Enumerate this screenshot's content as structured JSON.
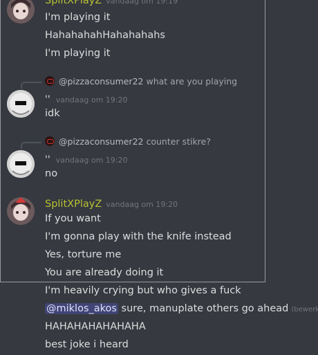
{
  "messages": [
    {
      "author": "SplitXPlayZ",
      "timestamp": "vandaag om 19:19",
      "lines": [
        "I'm playing it",
        "HahahahahHahahahahs",
        "I'm playing it"
      ]
    },
    {
      "reply": {
        "name": "@pizzaconsumer22",
        "snippet": "what are you playing"
      },
      "prefix": "''",
      "timestamp": "vandaag om 19:20",
      "lines": [
        "idk"
      ]
    },
    {
      "reply": {
        "name": "@pizzaconsumer22",
        "snippet": "counter stikre?"
      },
      "prefix": "''",
      "timestamp": "vandaag om 19:20",
      "lines": [
        "no"
      ]
    },
    {
      "author": "SplitXPlayZ",
      "timestamp": "vandaag om 19:20",
      "lines": [
        "If you want",
        "I'm gonna play with the knife instead",
        "Yes, torture me",
        "You are already doing it",
        "I'm heavily crying but who gives a fuck"
      ],
      "mention_line": {
        "mention": "@miklos_akos",
        "text": " sure, manuplate others go ahead",
        "edited": "(bewerkt)"
      },
      "more_lines": [
        "HAHAHAHAHAHAHA",
        "best joke i heard"
      ]
    }
  ],
  "colors": {
    "background": "#36393f",
    "author": "#b9c233",
    "text": "#dcddde",
    "timestamp": "#72767d",
    "mention_bg": "#5865f2"
  }
}
